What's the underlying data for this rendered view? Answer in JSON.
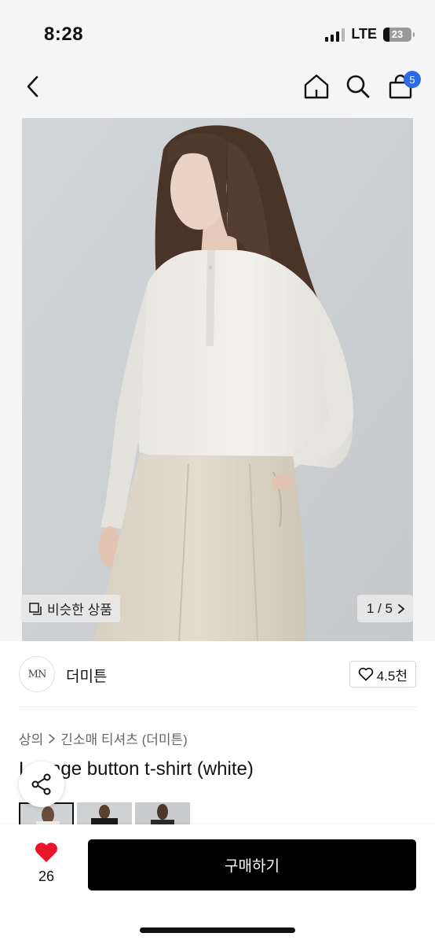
{
  "status_bar": {
    "time": "8:28",
    "network": "LTE",
    "battery": "23",
    "battery_level": 0.23
  },
  "top_nav": {
    "back_icon": "chevron-left-icon",
    "home_icon": "home-icon",
    "search_icon": "search-icon",
    "cart_icon": "shopping-bag-icon",
    "cart_count": "5"
  },
  "gallery": {
    "similar_label": "비슷한 상품",
    "page_counter": "1 / 5"
  },
  "seller": {
    "logo_text": "MN",
    "name": "더미튼",
    "like_count": "4.5천"
  },
  "breadcrumb": {
    "category": "상의",
    "subcategory": "긴소매 티셔츠 (더미튼)"
  },
  "product": {
    "title": "Lounge button t-shirt (white)"
  },
  "bottom_bar": {
    "like_count": "26",
    "buy_label": "구매하기"
  },
  "colors": {
    "accent_blue": "#2b6be8",
    "heart_red": "#e8152b",
    "buy_button": "#000000"
  }
}
